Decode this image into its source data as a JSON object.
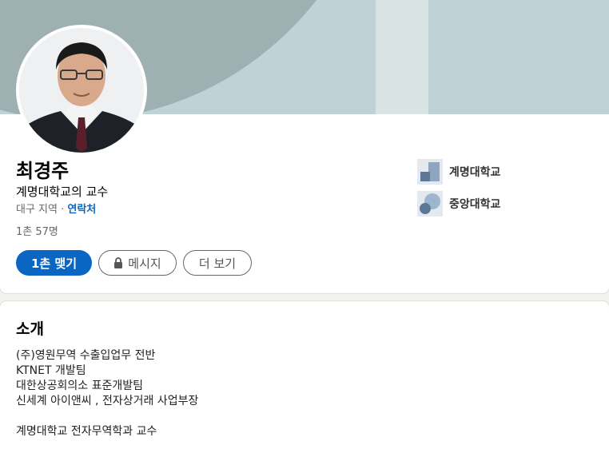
{
  "profile": {
    "name": "최경주",
    "headline": "계명대학교의 교수",
    "location": "대구 지역",
    "separator": " · ",
    "contact_label": "연락처",
    "connections": "1촌 57명"
  },
  "actions": {
    "connect_label": "1촌 맺기",
    "message_label": "메시지",
    "more_label": "더 보기"
  },
  "education": [
    {
      "name": "계명대학교",
      "icon": "school-logo-icon"
    },
    {
      "name": "중앙대학교",
      "icon": "school-logo-icon"
    }
  ],
  "about": {
    "title": "소개",
    "lines": [
      "(주)영원무역 수출입업무 전반",
      "KTNET 개발팀",
      "대한상공회의소 표준개발팀",
      "신세계 아이앤씨 , 전자상거래 사업부장",
      "",
      "계명대학교 전자무역학과 교수"
    ]
  },
  "colors": {
    "accent": "#0a66c2",
    "cover_dark": "#9fb0b2",
    "cover_light": "#bfd3d6"
  }
}
